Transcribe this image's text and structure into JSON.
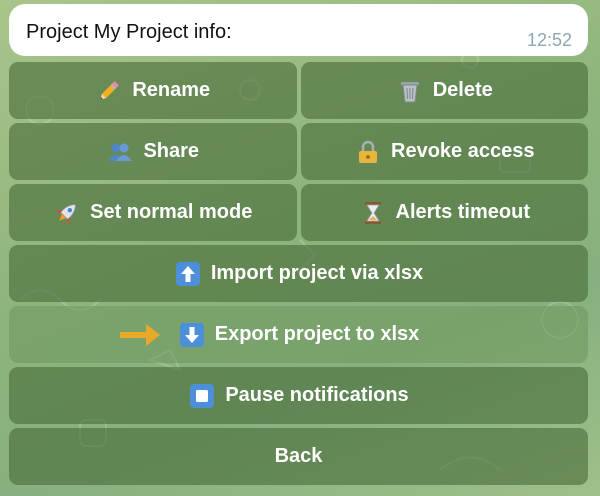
{
  "message": {
    "text": "Project My Project info:",
    "time": "12:52"
  },
  "keyboard": {
    "rename_label": "Rename",
    "delete_label": "Delete",
    "share_label": "Share",
    "revoke_access_label": "Revoke access",
    "set_normal_mode_label": "Set normal mode",
    "alerts_timeout_label": "Alerts timeout",
    "import_label": "Import project via xlsx",
    "export_label": "Export project to xlsx",
    "pause_label": "Pause notifications",
    "back_label": "Back"
  },
  "icons": {
    "rename": "pencil-icon",
    "delete": "trash-icon",
    "share": "people-icon",
    "revoke_access": "lock-icon",
    "set_normal_mode": "rocket-icon",
    "alerts_timeout": "hourglass-icon",
    "import": "up-arrow-icon",
    "export": "down-arrow-icon",
    "pause": "stop-icon",
    "pointer": "pointing-arrow-icon"
  },
  "colors": {
    "button_bg": "#486c3a",
    "highlight_arrow": "#e8a92a",
    "time_text": "#8fa6b3"
  }
}
